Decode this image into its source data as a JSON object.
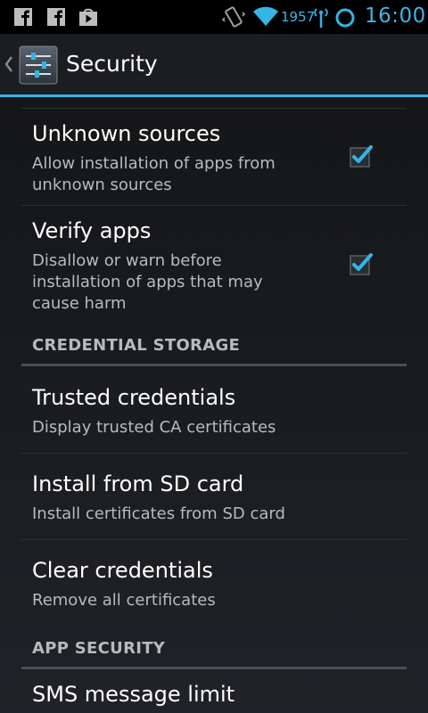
{
  "status_bar": {
    "left_icons": [
      "facebook-icon",
      "facebook-icon",
      "youtube-icon"
    ],
    "right_icons": [
      "vibrate-icon",
      "wifi-icon",
      "signal-icon",
      "sync-circle-icon"
    ],
    "signal_text": "1957",
    "clock": "16:00",
    "accent_color": "#33b5e5"
  },
  "action_bar": {
    "title": "Security",
    "icon": "settings-sliders-icon",
    "up_icon": "chevron-left-icon"
  },
  "preferences": {
    "unknown_sources": {
      "title": "Unknown sources",
      "summary": "Allow installation of apps from unknown sources",
      "checked": true
    },
    "verify_apps": {
      "title": "Verify apps",
      "summary": "Disallow or warn before installation of apps that may cause harm",
      "checked": true
    }
  },
  "sections": {
    "credential_storage": {
      "header": "CREDENTIAL STORAGE",
      "items": [
        {
          "title": "Trusted credentials",
          "summary": "Display trusted CA certificates"
        },
        {
          "title": "Install from SD card",
          "summary": "Install certificates from SD card"
        },
        {
          "title": "Clear credentials",
          "summary": "Remove all certificates"
        }
      ]
    },
    "app_security": {
      "header": "APP SECURITY",
      "items": [
        {
          "title": "SMS message limit"
        }
      ]
    }
  }
}
